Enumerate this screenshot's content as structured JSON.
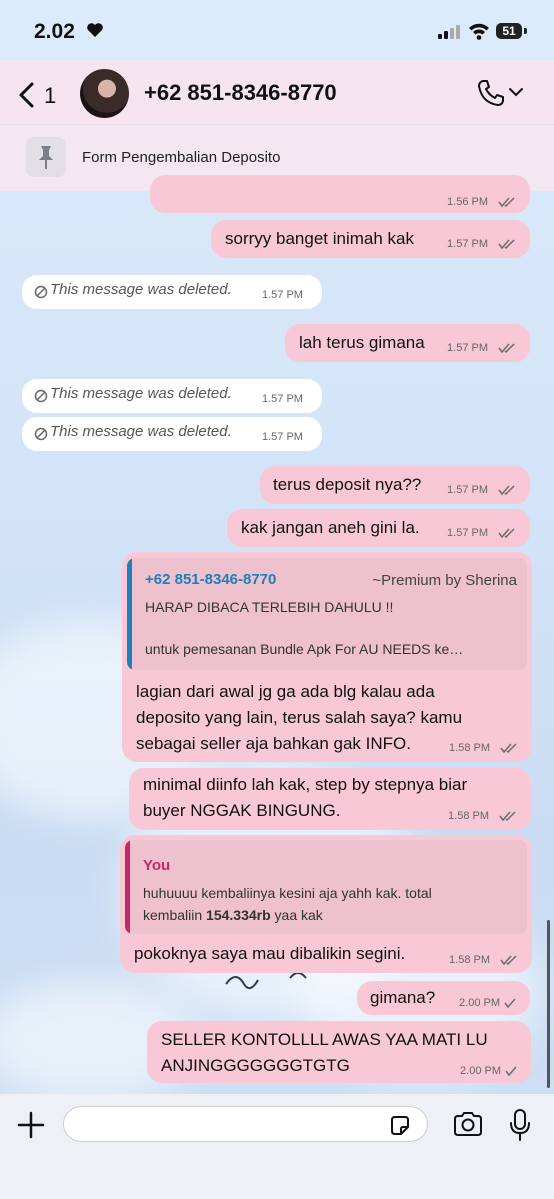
{
  "status_bar": {
    "time": "2.02",
    "battery": "51"
  },
  "header": {
    "back_count": "1",
    "contact_name": "+62 851-8346-8770",
    "pinned_message": "Form Pengembalian Deposito"
  },
  "messages": [
    {
      "type": "outgoing",
      "time": "1.56 PM",
      "ticks": "double"
    },
    {
      "type": "outgoing",
      "text": "sorryy banget inimah kak",
      "time": "1.57 PM",
      "ticks": "double"
    },
    {
      "type": "deleted",
      "text": "This message was deleted.",
      "time": "1.57 PM"
    },
    {
      "type": "outgoing",
      "text": "lah terus gimana",
      "time": "1.57 PM",
      "ticks": "double"
    },
    {
      "type": "deleted",
      "text": "This message was deleted.",
      "time": "1.57 PM"
    },
    {
      "type": "deleted",
      "text": "This message was deleted.",
      "time": "1.57 PM"
    },
    {
      "type": "outgoing",
      "text": "terus deposit nya??",
      "time": "1.57 PM",
      "ticks": "double"
    },
    {
      "type": "outgoing",
      "text": "kak jangan aneh gini la.",
      "time": "1.57 PM",
      "ticks": "double"
    },
    {
      "type": "outgoing-reply",
      "quote": {
        "name": "+62 851-8346-8770",
        "tag": "~Premium by Sherina",
        "line1": "HARAP DIBACA TERLEBIH DAHULU !!",
        "line2": "untuk pemesanan Bundle Apk For AU NEEDS ke…",
        "color": "#1f7fb8"
      },
      "lines": [
        "lagian dari awal jg ga ada blg kalau ada",
        "deposito yang lain, terus salah saya? kamu",
        "sebagai seller aja bahkan gak INFO."
      ],
      "time": "1.58 PM",
      "ticks": "double"
    },
    {
      "type": "outgoing",
      "lines": [
        "minimal diinfo lah kak, step by stepnya biar",
        "buyer NGGAK BINGUNG."
      ],
      "time": "1.58 PM",
      "ticks": "double"
    },
    {
      "type": "outgoing-reply",
      "quote": {
        "name": "You",
        "line1": "huhuuuu kembaliinya kesini aja yahh kak. total",
        "line2_pre": "kembaliin ",
        "line2_bold": "154.334rb",
        "line2_post": " yaa kak",
        "color": "#c2296a"
      },
      "lines": [
        "pokoknya saya mau dibalikin segini."
      ],
      "time": "1.58 PM",
      "ticks": "double"
    },
    {
      "type": "outgoing",
      "text": "gimana?",
      "time": "2.00 PM",
      "ticks": "single"
    },
    {
      "type": "outgoing",
      "lines": [
        "SELLER KONTOLLLL AWAS YAA MATI LU",
        "ANJINGGGGGGGTGTG"
      ],
      "time": "2.00 PM",
      "ticks": "single"
    }
  ],
  "colors": {
    "outgoing_bubble": "#f8c8d7",
    "incoming_bubble": "#ffffff",
    "header_bg": "#f7e4ed",
    "read_ticks": "#6b6b6b"
  },
  "icons": [
    "heart-icon",
    "signal-icon",
    "wifi-icon",
    "battery-icon",
    "back-arrow-icon",
    "phone-icon",
    "chevron-down-icon",
    "pin-icon",
    "deleted-icon",
    "plus-icon",
    "sticker-icon",
    "camera-icon",
    "microphone-icon"
  ]
}
